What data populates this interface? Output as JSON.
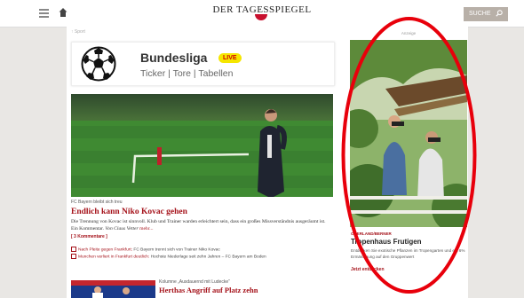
{
  "header": {
    "logo_text": "DER TAGESSPIEGEL",
    "search_label": "SUCHE",
    "icons": [
      "menu-icon",
      "home-icon",
      "search-icon"
    ]
  },
  "breadcrumb": "↑ Sport",
  "live_widget": {
    "title": "Bundesliga",
    "live_badge": "LIVE",
    "subtitle": "Ticker | Tore | Tabellen",
    "badge_color": "#f5e600"
  },
  "article": {
    "kicker": "FC Bayern bleibt sich treu",
    "headline": "Endlich kann Niko Kovac gehen",
    "teaser": "Die Trennung von Kovac ist sinnvoll. Klub und Trainer warden erleichtert sein, dass ein großes Missverständnis ausgeräumt ist. Ein Kommentar.",
    "author": "Von Claus Vetter",
    "more": "mehr...",
    "comments": "[ 3 Kommentare ]",
    "related": [
      {
        "link": "Nach Pleite gegen Frankfurt:",
        "text": "FC Bayern trennt sich von Trainer Niko Kovac"
      },
      {
        "link": "Munchen verliert in Frankfurt deutlich:",
        "text": "Hochste Niederlage seit zehn Jahren – FC Bayern am Boden"
      }
    ]
  },
  "article2": {
    "kicker": "Kolumne „Ausdauernd mit Ludecke“",
    "headline": "Herthas Angriff auf Platz zehn"
  },
  "ad": {
    "label": "Anzeige",
    "tag": "OBERLAND/BERNER",
    "title": "Tropenhaus Frutigen",
    "text": "Entdecken Sie exotische Pflanzen im Tropengarten und ein 6% Ermässigung auf den Gruppenwert",
    "link": "Jetzt entdecken"
  },
  "colors": {
    "accent": "#a5121a",
    "annotation": "#e8000b"
  }
}
